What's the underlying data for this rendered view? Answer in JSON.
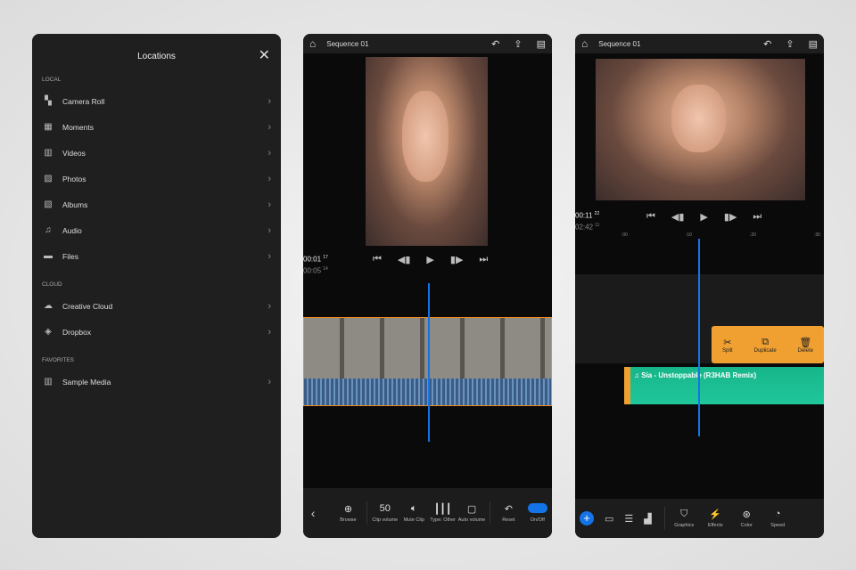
{
  "locations": {
    "title": "Locations",
    "close_icon": "close-icon",
    "sections": [
      {
        "label": "LOCAL",
        "items": [
          {
            "label": "Camera Roll",
            "icon": "camera-roll-icon"
          },
          {
            "label": "Moments",
            "icon": "calendar-icon"
          },
          {
            "label": "Videos",
            "icon": "film-icon"
          },
          {
            "label": "Photos",
            "icon": "image-icon"
          },
          {
            "label": "Albums",
            "icon": "albums-icon"
          },
          {
            "label": "Audio",
            "icon": "music-note-icon"
          },
          {
            "label": "Files",
            "icon": "folder-icon"
          }
        ]
      },
      {
        "label": "CLOUD",
        "items": [
          {
            "label": "Creative Cloud",
            "icon": "creative-cloud-icon"
          },
          {
            "label": "Dropbox",
            "icon": "dropbox-icon"
          }
        ]
      },
      {
        "label": "FAVORITES",
        "items": [
          {
            "label": "Sample Media",
            "icon": "film-icon"
          }
        ]
      }
    ]
  },
  "editor1": {
    "title": "Sequence 01",
    "timecode_current": "00:01",
    "timecode_current_frames": "17",
    "timecode_duration": "00:05",
    "timecode_duration_frames": "14",
    "tools": [
      {
        "value": "",
        "label": "Browse"
      },
      {
        "value": "50",
        "label": "Clip volume"
      },
      {
        "value": "",
        "label": "Mute Clip"
      },
      {
        "value": "",
        "label": "Type: Other"
      },
      {
        "value": "",
        "label": "Auto volume"
      },
      {
        "value": "",
        "label": "Reset"
      },
      {
        "value": "",
        "label": "On/Off"
      }
    ]
  },
  "editor2": {
    "title": "Sequence 01",
    "timecode_current": "00:11",
    "timecode_current_frames": "22",
    "timecode_duration": "02:42",
    "timecode_duration_frames": "11",
    "ruler": [
      ":00",
      ":10",
      ":20",
      ":30"
    ],
    "context_menu": [
      {
        "label": "Split",
        "icon": "scissors-icon"
      },
      {
        "label": "Duplicate",
        "icon": "duplicate-icon"
      },
      {
        "label": "Delete",
        "icon": "trash-icon"
      }
    ],
    "audio_clip": "Sia - Unstoppable (R3HAB Remix)",
    "tools": [
      "Graphics",
      "Effects",
      "Color",
      "Speed"
    ]
  },
  "colors": {
    "accent": "#1473e6",
    "selection": "#f0a030",
    "audio": "#1fc79a"
  }
}
